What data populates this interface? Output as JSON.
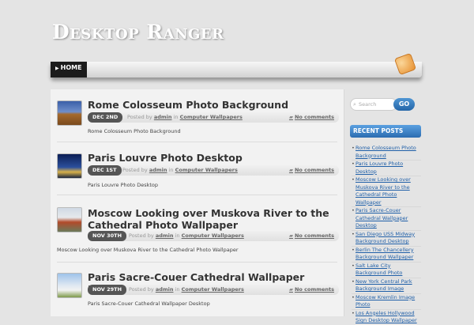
{
  "site": {
    "title": "Desktop Ranger"
  },
  "nav": {
    "home": "HOME"
  },
  "posts": [
    {
      "title": "Rome Colosseum Photo Background",
      "date": "DEC 2ND",
      "posted_by": "Posted by",
      "author": "admin",
      "in": "in",
      "category": "Computer Wallpapers",
      "comments": "No comments",
      "excerpt": "Rome Colosseum Photo Background"
    },
    {
      "title": "Paris Louvre Photo Desktop",
      "date": "DEC 1ST",
      "posted_by": "Posted by",
      "author": "admin",
      "in": "in",
      "category": "Computer Wallpapers",
      "comments": "No comments",
      "excerpt": "Paris Louvre Photo Desktop"
    },
    {
      "title": "Moscow Looking over Muskova River to the Cathedral Photo Wallpaper",
      "date": "NOV 30TH",
      "posted_by": "Posted by",
      "author": "admin",
      "in": "in",
      "category": "Computer Wallpapers",
      "comments": "No comments",
      "excerpt": "Moscow Looking over Muskova River to the Cathedral Photo Wallpaper"
    },
    {
      "title": "Paris Sacre-Couer Cathedral Wallpaper Desktop",
      "date": "NOV 29TH",
      "posted_by": "Posted by",
      "author": "admin",
      "in": "in",
      "category": "Computer Wallpapers",
      "comments": "No comments",
      "excerpt": "Paris Sacre-Couer Cathedral Wallpaper Desktop"
    }
  ],
  "sidebar": {
    "search_placeholder": "Search",
    "search_button": "GO",
    "recent_title": "RECENT POSTS",
    "recent": [
      "Rome Colosseum Photo Background",
      "Paris Louvre Photo Desktop",
      "Moscow Looking over Muskova River to the Cathedral Photo Wallpaper",
      "Paris Sacre-Couer Cathedral Wallpaper Desktop",
      "San Diego USS Midway Background Desktop",
      "Berlin The Chancellery Background Wallpaper",
      "Salt Lake City Background Photo",
      "New York Central Park Background Image",
      "Moscow Kremlin Image Photo",
      "Los Angeles Hollywood Sign Desktop Wallpaper"
    ]
  },
  "colors": {
    "accent": "#2b6cb0",
    "badge": "#555555",
    "link": "#1f5fa8"
  }
}
